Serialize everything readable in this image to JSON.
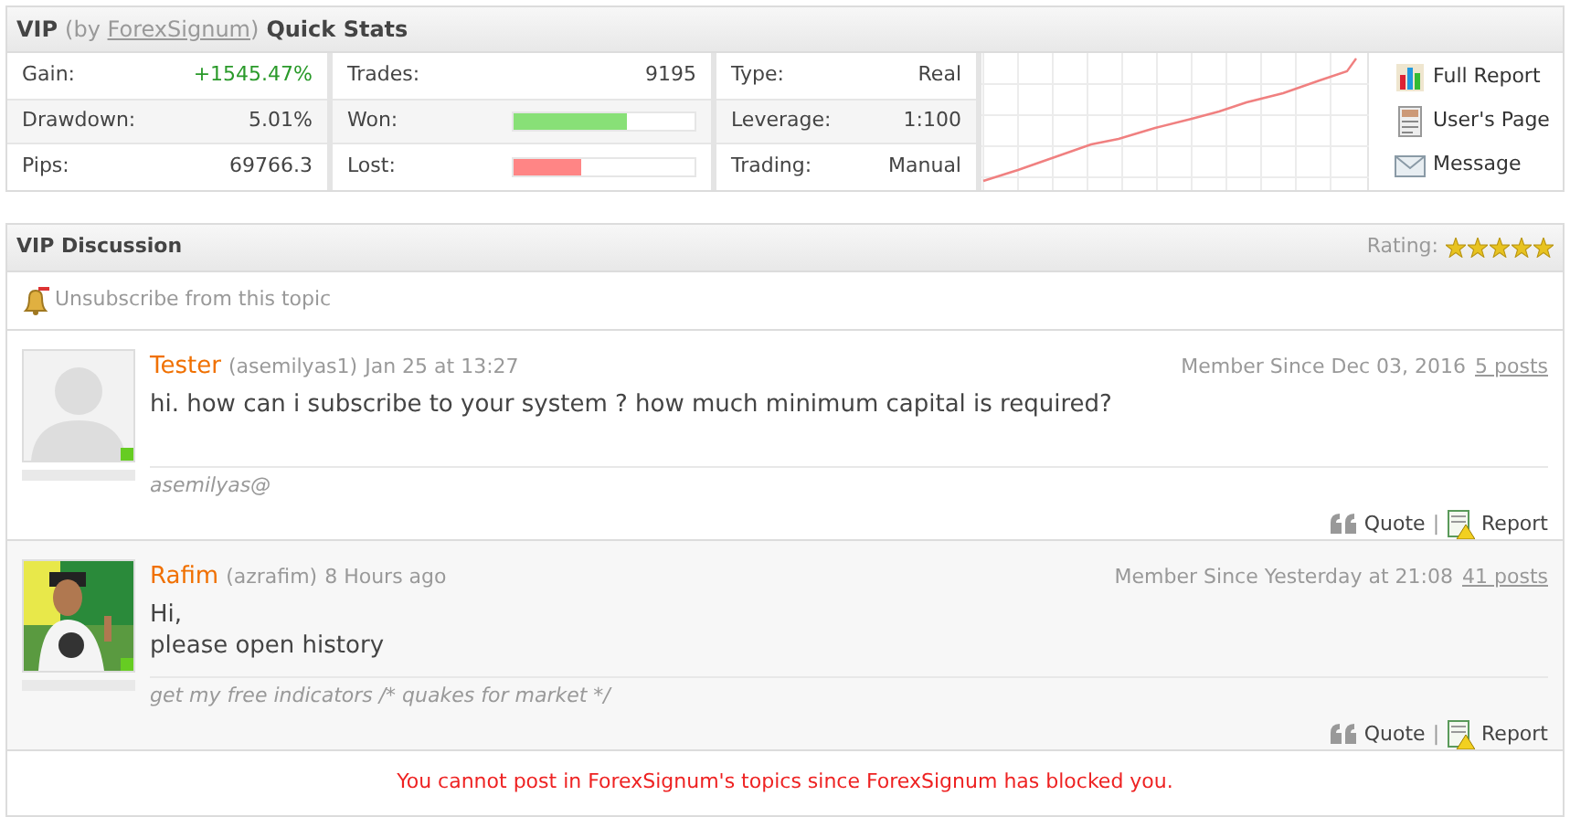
{
  "stats_panel": {
    "title_prefix": "VIP",
    "by_open": "(by",
    "owner": "ForexSignum",
    "by_close": ")",
    "title_suffix": "Quick Stats",
    "columns": [
      {
        "rows": [
          {
            "kind": "text",
            "label": "Gain:",
            "value": "+1545.47%",
            "positive": true
          },
          {
            "kind": "text",
            "label": "Drawdown:",
            "value": "5.01%",
            "positive": false
          },
          {
            "kind": "text",
            "label": "Pips:",
            "value": "69766.3",
            "positive": false
          }
        ]
      },
      {
        "rows": [
          {
            "kind": "text",
            "label": "Trades:",
            "value": "9195",
            "positive": false
          },
          {
            "kind": "bar",
            "label": "Won:",
            "level": 0.63,
            "color": "#88e077"
          },
          {
            "kind": "bar",
            "label": "Lost:",
            "level": 0.37,
            "color": "#ff8585"
          }
        ]
      },
      {
        "rows": [
          {
            "kind": "text",
            "label": "Type:",
            "value": "Real",
            "positive": false
          },
          {
            "kind": "text",
            "label": "Leverage:",
            "value": "1:100",
            "positive": false
          },
          {
            "kind": "text",
            "label": "Trading:",
            "value": "Manual",
            "positive": false
          }
        ]
      }
    ],
    "links": [
      {
        "kind": "report",
        "label": "Full Report"
      },
      {
        "kind": "page",
        "label": "User's Page"
      },
      {
        "kind": "message",
        "label": "Message"
      }
    ]
  },
  "discussion": {
    "title": "VIP Discussion",
    "rating_label": "Rating:",
    "stars": 5,
    "unsubscribe": "Unsubscribe from this topic",
    "posts": [
      {
        "kind": "avatar",
        "online": true,
        "author": "Tester",
        "username": "(asemilyas1)",
        "time": "Jan 25 at 13:27",
        "member_since": "Member Since Dec 03, 2016",
        "posts_count": "5 posts",
        "lines": [
          "hi. how can i subscribe to your system ? how much minimum capital is required?"
        ],
        "signature": "asemilyas@",
        "quote": "Quote",
        "separator": "|",
        "report": "Report"
      },
      {
        "kind": "picture",
        "online": true,
        "author": "Rafim",
        "username": "(azrafim)",
        "time": "8 Hours ago",
        "member_since": "Member Since Yesterday at 21:08",
        "posts_count": "41 posts",
        "lines": [
          "Hi,",
          "please open history"
        ],
        "signature": "get my free indicators /* quakes for market */",
        "quote": "Quote",
        "separator": "|",
        "report": "Report"
      }
    ],
    "blocked_notice": "You cannot post in ForexSignum's topics since ForexSignum has blocked you."
  }
}
